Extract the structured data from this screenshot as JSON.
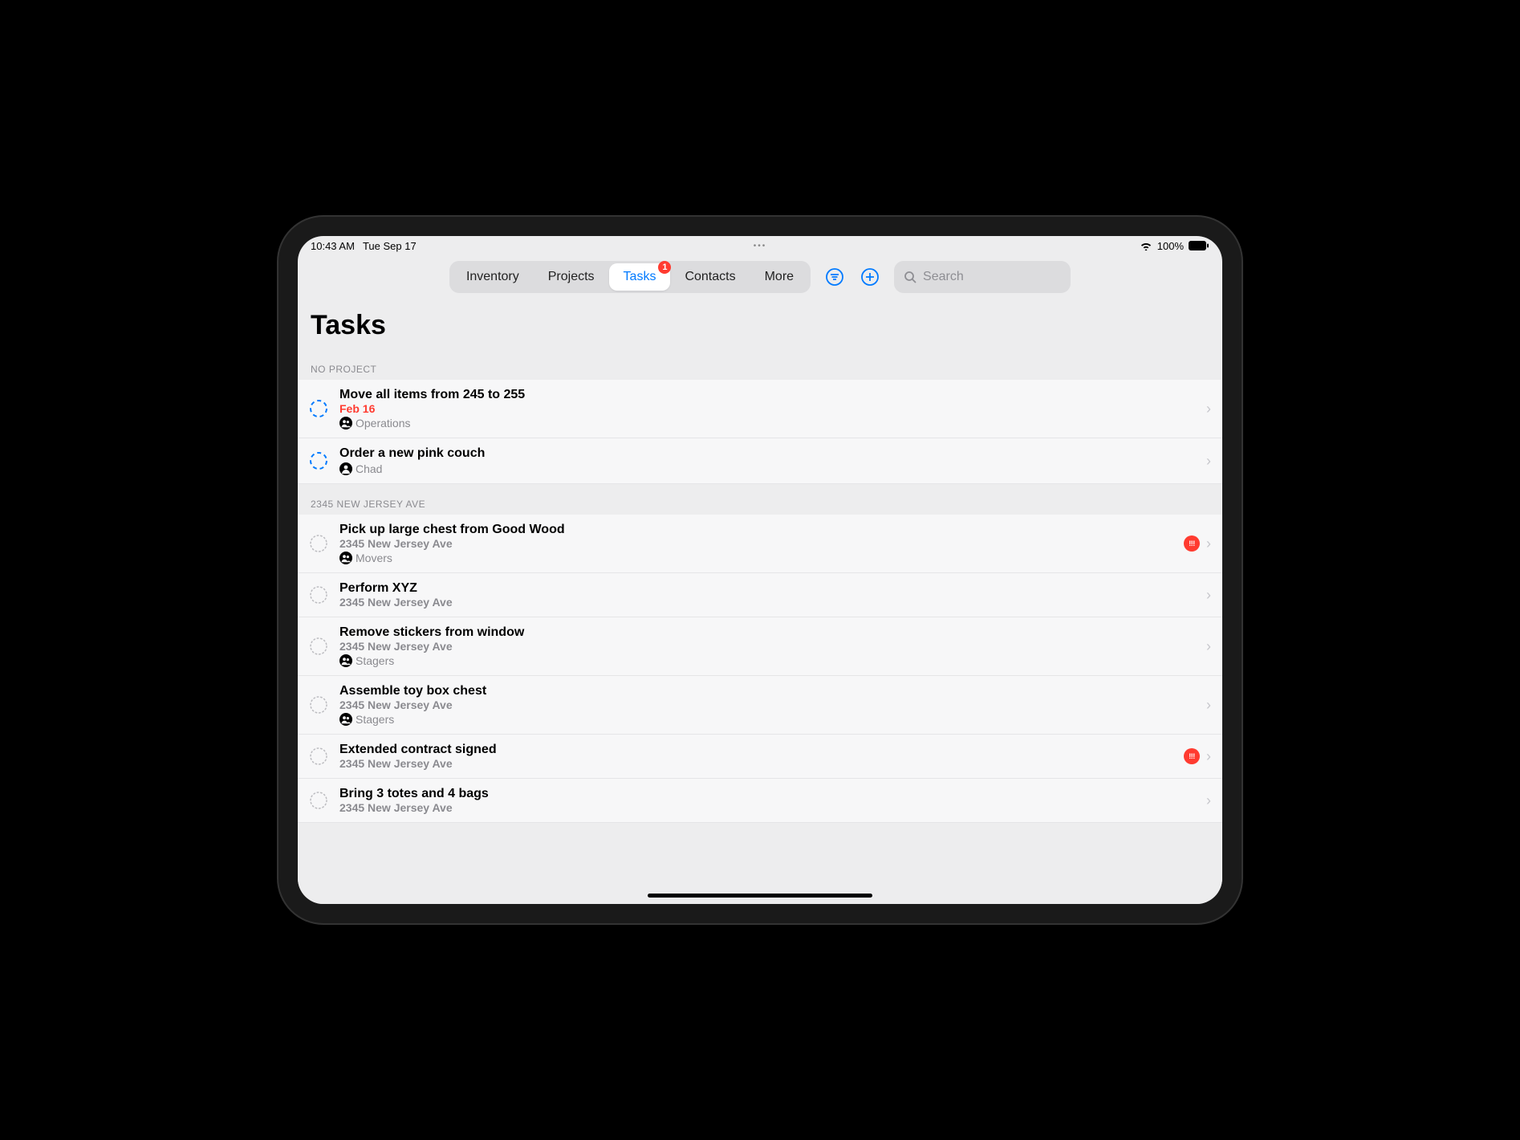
{
  "status_bar": {
    "time": "10:43 AM",
    "date": "Tue Sep 17",
    "battery": "100%"
  },
  "nav": {
    "tabs": [
      {
        "label": "Inventory",
        "active": false,
        "badge": null
      },
      {
        "label": "Projects",
        "active": false,
        "badge": null
      },
      {
        "label": "Tasks",
        "active": true,
        "badge": "1"
      },
      {
        "label": "Contacts",
        "active": false,
        "badge": null
      },
      {
        "label": "More",
        "active": false,
        "badge": null
      }
    ],
    "search_placeholder": "Search"
  },
  "page": {
    "title": "Tasks"
  },
  "sections": [
    {
      "header": "NO PROJECT",
      "tasks": [
        {
          "title": "Move all items from 245 to 255",
          "due": "Feb 16",
          "due_overdue": true,
          "subtitle": null,
          "assignee": "Operations",
          "assignee_type": "group",
          "circle": "dashed-blue",
          "priority": false
        },
        {
          "title": "Order a new pink couch",
          "due": null,
          "subtitle": null,
          "assignee": "Chad",
          "assignee_type": "person",
          "circle": "dashed-blue",
          "priority": false
        }
      ]
    },
    {
      "header": "2345 NEW JERSEY AVE",
      "tasks": [
        {
          "title": "Pick up large chest from Good Wood",
          "subtitle": "2345 New Jersey Ave",
          "assignee": "Movers",
          "assignee_type": "group",
          "circle": "dotted-gray",
          "priority": true
        },
        {
          "title": "Perform XYZ",
          "subtitle": "2345 New Jersey Ave",
          "assignee": null,
          "circle": "dotted-gray",
          "priority": false
        },
        {
          "title": "Remove stickers from window",
          "subtitle": "2345 New Jersey Ave",
          "assignee": "Stagers",
          "assignee_type": "group",
          "circle": "dotted-gray",
          "priority": false
        },
        {
          "title": "Assemble toy box chest",
          "subtitle": "2345 New Jersey Ave",
          "assignee": "Stagers",
          "assignee_type": "group",
          "circle": "dotted-gray",
          "priority": false
        },
        {
          "title": "Extended contract signed",
          "subtitle": "2345 New Jersey Ave",
          "assignee": null,
          "circle": "dotted-gray",
          "priority": true
        },
        {
          "title": "Bring 3 totes and 4 bags",
          "subtitle": "2345 New Jersey Ave",
          "assignee": null,
          "circle": "dotted-gray",
          "priority": false
        }
      ]
    }
  ],
  "colors": {
    "accent": "#007aff",
    "danger": "#ff3b30",
    "muted": "#8a8a8f"
  }
}
